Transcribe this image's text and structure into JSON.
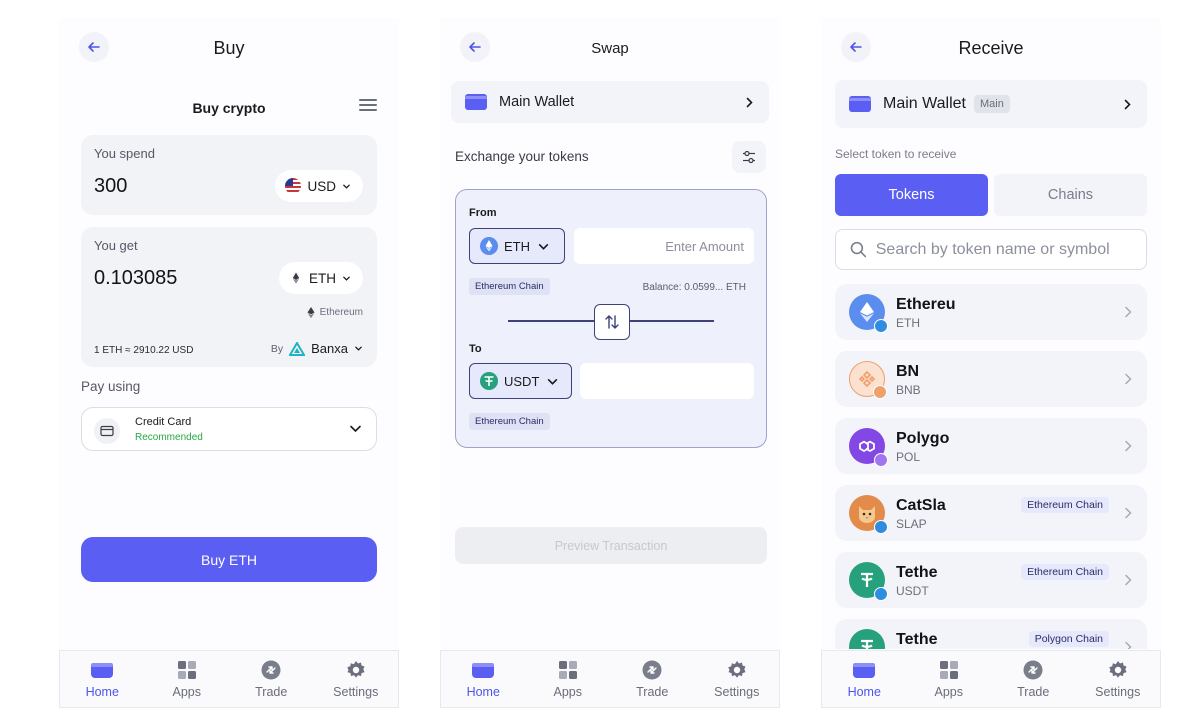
{
  "buy_screen": {
    "title": "Buy",
    "subtitle": "Buy crypto",
    "spend_label": "You spend",
    "spend_value": "300",
    "spend_currency": "USD",
    "get_label": "You get",
    "get_value": "0.103085",
    "get_currency": "ETH",
    "get_network": "Ethereum",
    "rate": "1 ETH ≈ 2910.22 USD",
    "provider_prefix": "By",
    "provider": "Banxa",
    "pay_using_label": "Pay using",
    "payment_method": "Credit Card",
    "payment_tag": "Recommended",
    "button": "Buy ETH"
  },
  "swap_screen": {
    "title": "Swap",
    "wallet": "Main Wallet",
    "exchange_label": "Exchange your tokens",
    "from_label": "From",
    "from_token": "ETH",
    "amount_placeholder": "Enter Amount",
    "from_chain": "Ethereum Chain",
    "balance": "Balance: 0.0599... ETH",
    "to_label": "To",
    "to_token": "USDT",
    "to_chain": "Ethereum Chain",
    "button": "Preview Transaction"
  },
  "receive_screen": {
    "title": "Receive",
    "wallet": "Main Wallet",
    "wallet_badge": "Main",
    "select_label": "Select token to receive",
    "tab_tokens": "Tokens",
    "tab_chains": "Chains",
    "search_placeholder": "Search by token name or symbol",
    "tokens": [
      {
        "name": "Ethereu",
        "symbol": "ETH",
        "chain": ""
      },
      {
        "name": "BN",
        "symbol": "BNB",
        "chain": ""
      },
      {
        "name": "Polygo",
        "symbol": "POL",
        "chain": ""
      },
      {
        "name": "CatSla",
        "symbol": "SLAP",
        "chain": "Ethereum Chain"
      },
      {
        "name": "Tethe",
        "symbol": "USDT",
        "chain": "Ethereum Chain"
      },
      {
        "name": "Tethe",
        "symbol": "",
        "chain": "Polygon Chain"
      }
    ]
  },
  "nav": {
    "home": "Home",
    "apps": "Apps",
    "trade": "Trade",
    "settings": "Settings"
  },
  "colors": {
    "accent": "#5a5ef2",
    "success": "#28a745",
    "eth": "#5b8def",
    "bnb": "#f0a06a",
    "polygon": "#8247e5",
    "tether": "#26a17b"
  },
  "icons": [
    "back-arrow-icon",
    "menu-icon",
    "us-flag-icon",
    "ethereum-icon",
    "banxa-logo-icon",
    "credit-card-icon",
    "chevron-down-icon",
    "wallet-icon",
    "chevron-right-icon",
    "sliders-icon",
    "swap-arrows-icon",
    "tether-icon",
    "search-icon",
    "bnb-icon",
    "polygon-icon",
    "catslap-icon",
    "home-icon",
    "apps-icon",
    "trade-icon",
    "gear-icon"
  ]
}
